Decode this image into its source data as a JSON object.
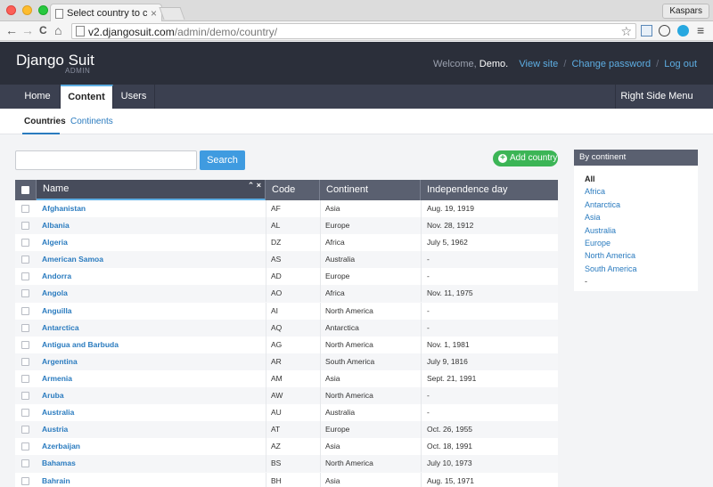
{
  "browser": {
    "tab_title": "Select country to change | Dj",
    "tab_close": "×",
    "profile": "Kaspars",
    "url_domain": "v2.djangosuit.com",
    "url_path": "/admin/demo/country/",
    "back": "←",
    "forward": "→",
    "reload": "C",
    "home": "⌂",
    "star": "☆",
    "menu": "≡"
  },
  "header": {
    "brand": "Django Suit",
    "brand_sub": "ADMIN",
    "welcome": "Welcome,",
    "user": "Demo",
    "user_suffix": ".",
    "view_site": "View site",
    "change_password": "Change password",
    "logout": "Log out",
    "sep": "/"
  },
  "nav": {
    "home": "Home",
    "content": "Content",
    "users": "Users",
    "right_menu": "Right Side Menu"
  },
  "subnav": {
    "countries": "Countries",
    "continents": "Continents"
  },
  "search": {
    "value": "",
    "button": "Search"
  },
  "add_button": "Add country",
  "add_plus": "+",
  "table": {
    "headers": {
      "name": "Name",
      "code": "Code",
      "continent": "Continent",
      "independence": "Independence day"
    },
    "sort_icons": "⌃ ×",
    "rows": [
      {
        "name": "Afghanistan",
        "code": "AF",
        "continent": "Asia",
        "independence": "Aug. 19, 1919"
      },
      {
        "name": "Albania",
        "code": "AL",
        "continent": "Europe",
        "independence": "Nov. 28, 1912"
      },
      {
        "name": "Algeria",
        "code": "DZ",
        "continent": "Africa",
        "independence": "July 5, 1962"
      },
      {
        "name": "American Samoa",
        "code": "AS",
        "continent": "Australia",
        "independence": "-"
      },
      {
        "name": "Andorra",
        "code": "AD",
        "continent": "Europe",
        "independence": "-"
      },
      {
        "name": "Angola",
        "code": "AO",
        "continent": "Africa",
        "independence": "Nov. 11, 1975"
      },
      {
        "name": "Anguilla",
        "code": "AI",
        "continent": "North America",
        "independence": "-"
      },
      {
        "name": "Antarctica",
        "code": "AQ",
        "continent": "Antarctica",
        "independence": "-"
      },
      {
        "name": "Antigua and Barbuda",
        "code": "AG",
        "continent": "North America",
        "independence": "Nov. 1, 1981"
      },
      {
        "name": "Argentina",
        "code": "AR",
        "continent": "South America",
        "independence": "July 9, 1816"
      },
      {
        "name": "Armenia",
        "code": "AM",
        "continent": "Asia",
        "independence": "Sept. 21, 1991"
      },
      {
        "name": "Aruba",
        "code": "AW",
        "continent": "North America",
        "independence": "-"
      },
      {
        "name": "Australia",
        "code": "AU",
        "continent": "Australia",
        "independence": "-"
      },
      {
        "name": "Austria",
        "code": "AT",
        "continent": "Europe",
        "independence": "Oct. 26, 1955"
      },
      {
        "name": "Azerbaijan",
        "code": "AZ",
        "continent": "Asia",
        "independence": "Oct. 18, 1991"
      },
      {
        "name": "Bahamas",
        "code": "BS",
        "continent": "North America",
        "independence": "July 10, 1973"
      },
      {
        "name": "Bahrain",
        "code": "BH",
        "continent": "Asia",
        "independence": "Aug. 15, 1971"
      }
    ]
  },
  "filter": {
    "title": "By continent",
    "items": [
      "All",
      "Africa",
      "Antarctica",
      "Asia",
      "Australia",
      "Europe",
      "North America",
      "South America",
      "-"
    ]
  }
}
